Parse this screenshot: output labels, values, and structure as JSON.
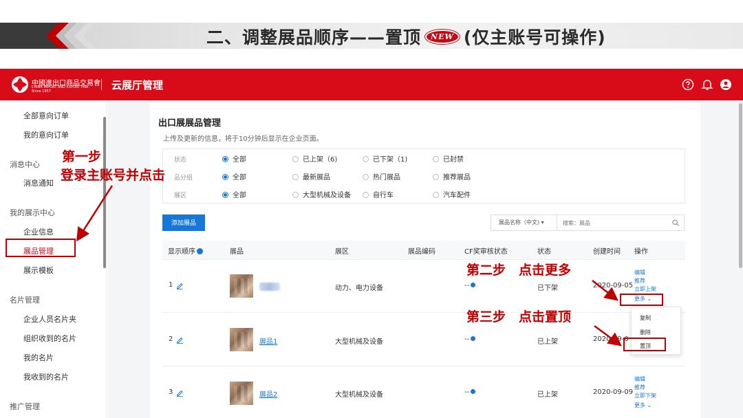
{
  "slide": {
    "title_main": "二、调整展品顺序——置顶",
    "badge": "NEW",
    "title_suffix": "(仅主账号可操作)"
  },
  "header": {
    "logo_cn": "中國進出口商品交易會",
    "logo_en": "CHINA IMPORT AND EXPORT FAIR",
    "logo_since": "Since 1957",
    "app_title": "云展厅管理",
    "icons": [
      "help-icon",
      "bell-icon",
      "user-icon"
    ]
  },
  "sidebar": {
    "items": [
      {
        "label": "全部意向订单"
      },
      {
        "label": "我的意向订单"
      },
      {
        "label": "消息中心"
      },
      {
        "label": "消息通知"
      },
      {
        "label": "我的展示中心"
      },
      {
        "label": "企业信息"
      },
      {
        "label": "展品管理"
      },
      {
        "label": "展示模板"
      },
      {
        "label": "名片管理"
      },
      {
        "label": "企业人员名片夹"
      },
      {
        "label": "组织收到的名片"
      },
      {
        "label": "我的名片"
      },
      {
        "label": "我收到的名片"
      },
      {
        "label": "推广管理"
      }
    ],
    "active": "展品管理"
  },
  "main": {
    "title": "出口展展品管理",
    "subtitle": "上传及更新的信息，将于10分钟后显示在企业页面。",
    "filters": [
      {
        "label": "状态",
        "options": [
          "全部",
          "已上架（6)",
          "已下架（1)",
          "已封禁"
        ],
        "selected": 0
      },
      {
        "label": "品分组",
        "options": [
          "全部",
          "最新展品",
          "热门展品",
          "推荐展品"
        ],
        "selected": 0
      },
      {
        "label": "展区",
        "options": [
          "全部",
          "大型机械及设备",
          "自行车",
          "汽车配件"
        ],
        "selected": 0
      }
    ],
    "add_button": "添加展品",
    "search": {
      "select_value": "展品名称（中文)",
      "placeholder": "搜索：展品"
    },
    "columns": [
      "显示顺序",
      "展品",
      "展区",
      "展品编码",
      "CF奖审核状态",
      "状态",
      "创建时间",
      "操作"
    ],
    "rows": [
      {
        "order": "1",
        "name": "",
        "zone": "动力、电力设备",
        "code": "",
        "cf": "--",
        "status": "已下架",
        "created": "2020-09-05",
        "ops": [
          "编辑",
          "推荐",
          "立即上架",
          "更多"
        ]
      },
      {
        "order": "2",
        "name": "展品1",
        "zone": "大型机械及设备",
        "code": "",
        "cf": "--",
        "status": "已上架",
        "created": "2020-09-0",
        "ops": []
      },
      {
        "order": "3",
        "name": "展品2",
        "zone": "大型机械及设备",
        "code": "",
        "cf": "--",
        "status": "已上架",
        "created": "2020-09-09",
        "ops": [
          "编辑",
          "推荐",
          "立即下架",
          "更多"
        ]
      }
    ],
    "more_menu": [
      "复制",
      "删除",
      "置顶"
    ]
  },
  "annotations": {
    "step1_title": "第一步",
    "step1_desc": "登录主账号并点击",
    "step2": "第二步　点击更多",
    "step3": "第三步　点击置顶"
  },
  "colors": {
    "brand_red": "#d80c18",
    "annotation_red": "#c00000",
    "primary_blue": "#1677d8"
  }
}
